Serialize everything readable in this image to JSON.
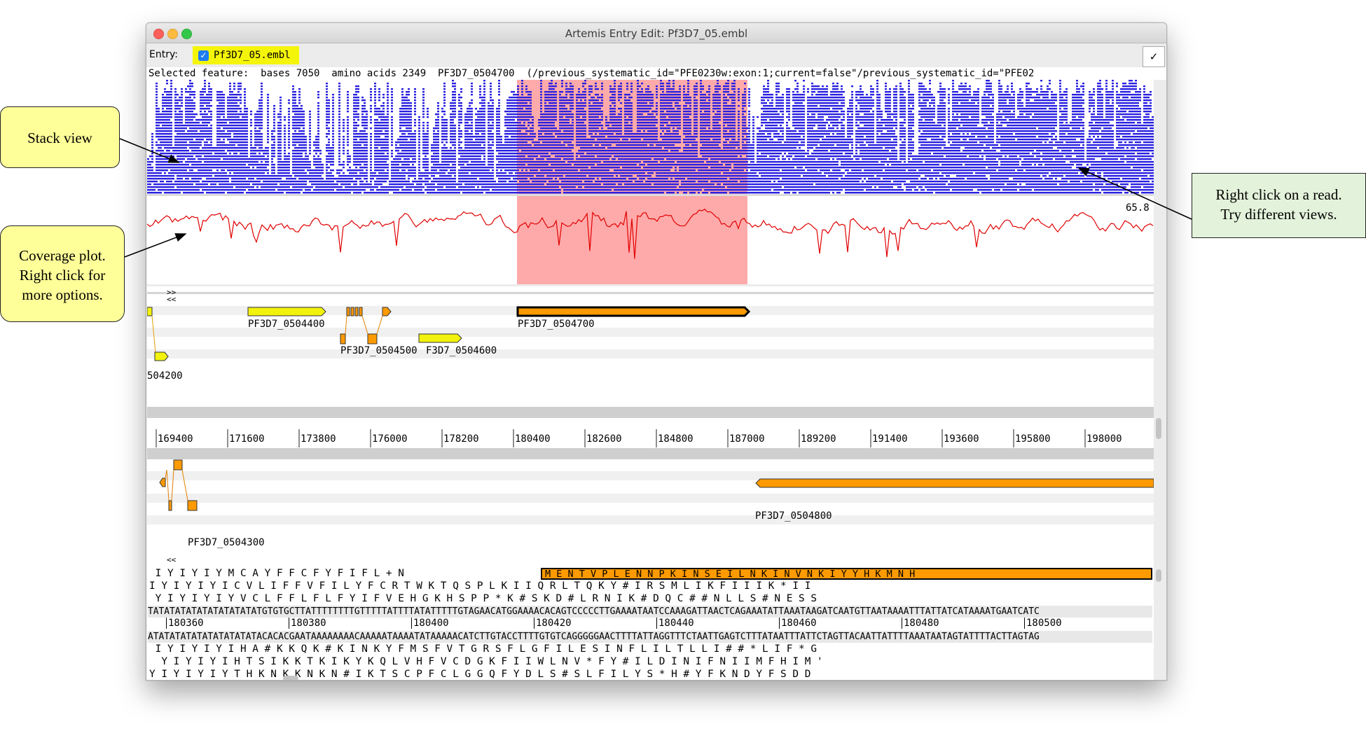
{
  "window": {
    "title": "Artemis Entry Edit: Pf3D7_05.embl",
    "entry_label": "Entry:",
    "entry_name": "Pf3D7_05.embl",
    "done_symbol": "✓"
  },
  "selected_feature": "Selected feature:  bases 7050  amino acids 2349  PF3D7_0504700  (/previous_systematic_id=\"PFE0230w:exon:1;current=false\"/previous_systematic_id=\"PFE02",
  "coverage": {
    "max_label": "65.8"
  },
  "colors": {
    "reads": "#2a20e0",
    "highlight": "#ffaaaa",
    "coverage_line": "#e00000",
    "gene_yellow": "#f2f20c",
    "gene_orange": "#ff9a00"
  },
  "features_top": {
    "nav": [
      ">>",
      "<<"
    ],
    "labels": [
      "PF3D7_0504400",
      "PF3D7_0504700",
      "PF3D7_0504500",
      "F3D7_0504600",
      "504200"
    ]
  },
  "ruler": {
    "ticks": [
      "169400",
      "171600",
      "173800",
      "176000",
      "178200",
      "180400",
      "182600",
      "184800",
      "187000",
      "189200",
      "191400",
      "193600",
      "195800",
      "198000"
    ]
  },
  "features_bottom": {
    "labels": [
      "PF3D7_0504300",
      "PF3D7_0504800"
    ]
  },
  "sequence": {
    "nav": "<<",
    "fwd_frames": [
      " I Y I Y I Y M C A Y F F C F Y F I F L + N ",
      "I Y I Y I Y I C V L I F F V F I L Y F C R T W K T Q S P L K I I Q R L T Q K Y # I R S M L I K F I I I K * I I",
      " Y I Y I Y I Y V C L F F L F L F Y I F V E H G K H S P P * K # S K D # L R N I K # D Q C # # N L L S # N E S S"
    ],
    "highlighted_aa": "M E N T V P L E N N P K I N S E I L N K I N V N K I Y Y H K M N H",
    "forward_strand": "TATATATATATATATATATATGTGTGCTTATTTTTTTTGTTTTTATTTTATATTTTTGTAGAACATGGAAAACACAGTCCCCCTTGAAAATAATCCAAAGATTAACTCAGAAATATTAAATAAGATCAATGTTAATAAAATTTATTATCATAAAATGAATCATC",
    "ticks": [
      "180360",
      "180380",
      "180400",
      "180420",
      "180440",
      "180460",
      "180480",
      "180500"
    ],
    "reverse_strand": "ATATATATATATATATATATACACACGAATAAAAAAAACAAAAATAAAATATAAAAACATCTTGTACCTTTTGTGTCAGGGGGAACTTTTATTAGGTTTCTAATTGAGTCTTTATAATTTATTCTAGTTACAATTATTTTAAATAATAGTATTTTACTTAGTAG",
    "rev_frames": [
      " I Y I Y I Y I H A # K K Q K # K I N K Y F M S F V T G R S F L G F I L E S I N F L I L T L L I # # * L I F * G",
      "  Y I Y I Y I H T S I K K T K I K Y K Q L V H F V C D G K F I I W L N V * F Y # I L D I N I F N I I M F H I M '",
      "Y I Y I Y I Y T H K N K K N K N # I K T S C P F C L G G Q F Y D L S # S L F I L Y S * H # Y F K N D Y F S D D"
    ]
  },
  "annotations": {
    "stack_view": "Stack view",
    "coverage_plot": [
      "Coverage plot.",
      "Right click for",
      "more options."
    ],
    "right_click": [
      "Right click on a read.",
      "Try different views."
    ]
  }
}
